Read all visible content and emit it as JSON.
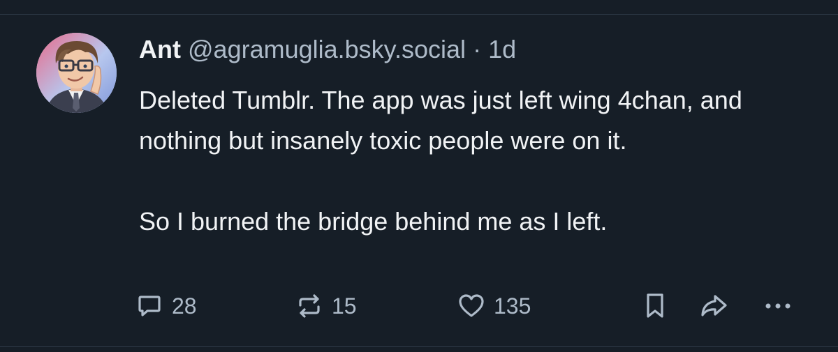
{
  "post": {
    "author": {
      "display_name": "Ant",
      "handle": "@agramuglia.bsky.social"
    },
    "separator": "·",
    "time": "1d",
    "paragraphs": [
      "Deleted Tumblr. The app was just left wing 4chan, and nothing but insanely toxic people were on it.",
      "So I burned the bridge behind me as I left."
    ],
    "actions": {
      "reply_count": "28",
      "repost_count": "15",
      "like_count": "135"
    }
  },
  "icons": {
    "reply": "speech-bubble-icon",
    "repost": "repost-arrows-icon",
    "like": "heart-icon",
    "bookmark": "bookmark-icon",
    "share": "share-arrow-icon",
    "more": "ellipsis-icon"
  },
  "colors": {
    "background": "#161e27",
    "text": "#f1f3f5",
    "muted": "#aebbc9",
    "divider": "#2e3a48"
  }
}
